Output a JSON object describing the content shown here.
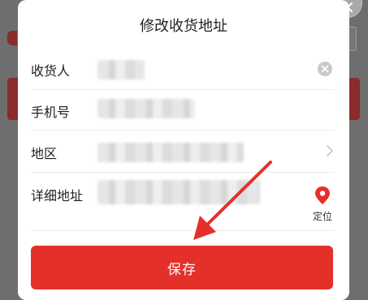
{
  "dialog": {
    "title": "修改收货地址",
    "fields": {
      "recipient_label": "收货人",
      "phone_label": "手机号",
      "region_label": "地区",
      "address_label": "详细地址"
    },
    "locate_label": "定位",
    "save_label": "保存"
  },
  "colors": {
    "accent": "#e5302a",
    "overlay": "#6e6e6e",
    "annotation_arrow": "#e5302a"
  },
  "icons": {
    "close": "close-icon",
    "clear": "clear-icon",
    "chevron": "chevron-right-icon",
    "locate": "location-pin-icon"
  }
}
